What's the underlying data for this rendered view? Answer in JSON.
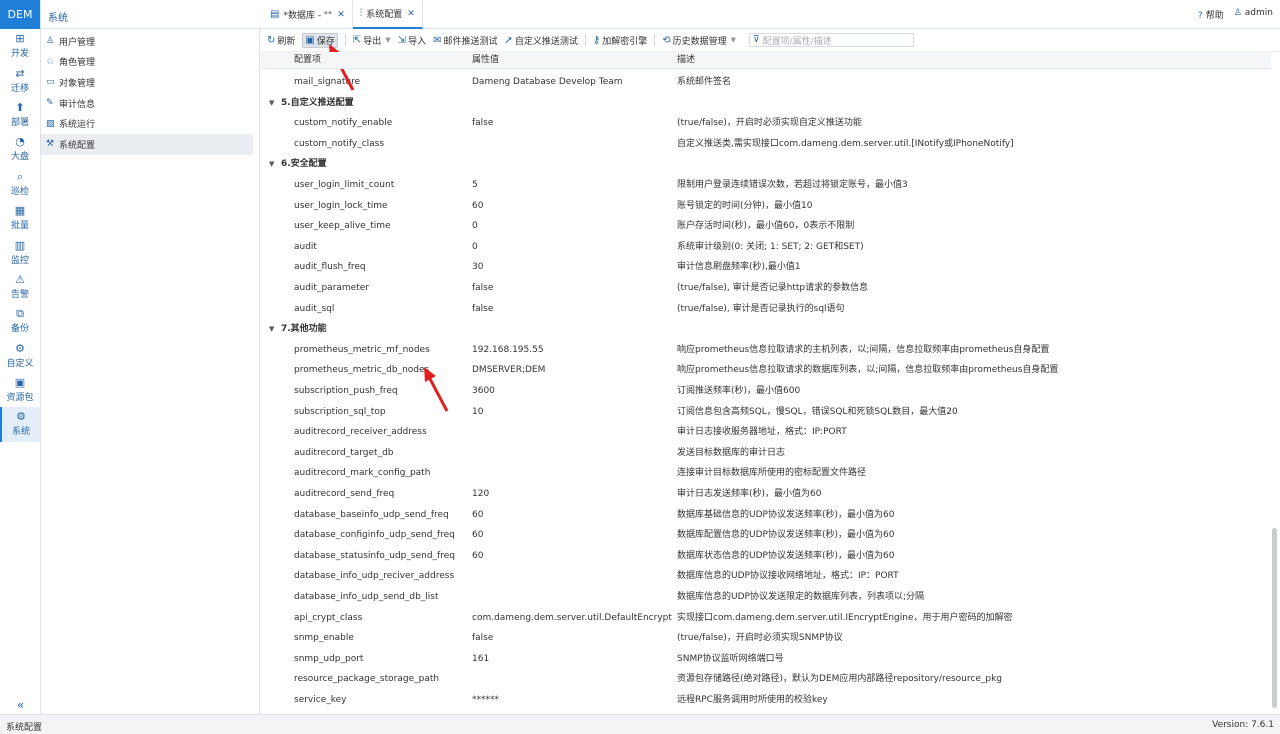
{
  "app": {
    "logo": "DEM",
    "section_title": "系统"
  },
  "header": {
    "tabs": [
      {
        "label": "*数据库 - \"\"",
        "icon": "table-icon",
        "active": false
      },
      {
        "label": "系统配置",
        "icon": "settings-sliders-icon",
        "active": true
      }
    ],
    "help_label": "帮助",
    "user_label": "admin"
  },
  "rail": {
    "items": [
      {
        "label": "开发",
        "icon": "grid-icon"
      },
      {
        "label": "迁移",
        "icon": "migrate-icon"
      },
      {
        "label": "部署",
        "icon": "deploy-icon"
      },
      {
        "label": "大盘",
        "icon": "dashboard-icon"
      },
      {
        "label": "巡检",
        "icon": "inspect-icon"
      },
      {
        "label": "批量",
        "icon": "batch-icon"
      },
      {
        "label": "监控",
        "icon": "monitor-icon"
      },
      {
        "label": "告警",
        "icon": "alarm-icon"
      },
      {
        "label": "备份",
        "icon": "backup-icon"
      },
      {
        "label": "自定义",
        "icon": "custom-icon"
      },
      {
        "label": "资源包",
        "icon": "package-icon"
      },
      {
        "label": "系统",
        "icon": "system-gear-icon"
      }
    ],
    "collapse_glyph": "«"
  },
  "nav": {
    "items": [
      {
        "label": "用户管理",
        "icon": "user-icon"
      },
      {
        "label": "角色管理",
        "icon": "role-icon"
      },
      {
        "label": "对象管理",
        "icon": "folder-icon"
      },
      {
        "label": "审计信息",
        "icon": "audit-icon"
      },
      {
        "label": "系统运行",
        "icon": "run-chart-icon"
      },
      {
        "label": "系统配置",
        "icon": "config-icon"
      }
    ]
  },
  "toolbar": {
    "refresh": "刷新",
    "save": "保存",
    "export": "导出",
    "import": "导入",
    "mail_test": "邮件推送测试",
    "custom_push_test": "自定义推送测试",
    "decrypt_index": "加解密引擎",
    "history": "历史数据管理",
    "filter_placeholder": "配置项/属性/描述"
  },
  "grid": {
    "headers": [
      "配置项",
      "属性值",
      "描述"
    ],
    "rows": [
      {
        "type": "row",
        "key": "mail_signature",
        "value": "Dameng Database Develop Team",
        "desc": "系统邮件签名"
      },
      {
        "type": "group",
        "name": "5.自定义推送配置"
      },
      {
        "type": "row",
        "key": "custom_notify_enable",
        "value": "false",
        "desc": "(true/false)，开启时必须实现自定义推送功能"
      },
      {
        "type": "row",
        "key": "custom_notify_class",
        "value": "",
        "desc": "自定义推送类,需实现接口com.dameng.dem.server.util.[INotify或IPhoneNotify]"
      },
      {
        "type": "group",
        "name": "6.安全配置"
      },
      {
        "type": "row",
        "key": "user_login_limit_count",
        "value": "5",
        "desc": "限制用户登录连续错误次数，若超过将锁定账号，最小值3"
      },
      {
        "type": "row",
        "key": "user_login_lock_time",
        "value": "60",
        "desc": "账号锁定的时间(分钟)，最小值10"
      },
      {
        "type": "row",
        "key": "user_keep_alive_time",
        "value": "0",
        "desc": "账户存活时间(秒)，最小值60，0表示不限制"
      },
      {
        "type": "row",
        "key": "audit",
        "value": "0",
        "desc": "系统审计级别(0: 关闭; 1: SET; 2: GET和SET)"
      },
      {
        "type": "row",
        "key": "audit_flush_freq",
        "value": "30",
        "desc": "审计信息刷盘频率(秒),最小值1"
      },
      {
        "type": "row",
        "key": "audit_parameter",
        "value": "false",
        "desc": "(true/false), 审计是否记录http请求的参数信息"
      },
      {
        "type": "row",
        "key": "audit_sql",
        "value": "false",
        "desc": "(true/false), 审计是否记录执行的sql语句"
      },
      {
        "type": "group",
        "name": "7.其他功能"
      },
      {
        "type": "row",
        "key": "prometheus_metric_mf_nodes",
        "value": "192.168.195.55",
        "desc": "响应prometheus信息拉取请求的主机列表，以;间隔，信息拉取频率由prometheus自身配置"
      },
      {
        "type": "row",
        "key": "prometheus_metric_db_nodes",
        "value": "DMSERVER;DEM",
        "desc": "响应prometheus信息拉取请求的数据库列表，以;间隔，信息拉取频率由prometheus自身配置"
      },
      {
        "type": "row",
        "key": "subscription_push_freq",
        "value": "3600",
        "desc": "订阅推送频率(秒)，最小值600"
      },
      {
        "type": "row",
        "key": "subscription_sql_top",
        "value": "10",
        "desc": "订阅信息包含高频SQL，慢SQL，错误SQL和死锁SQL数目，最大值20"
      },
      {
        "type": "row",
        "key": "auditrecord_receiver_address",
        "value": "",
        "desc": "审计日志接收服务器地址，格式：IP:PORT"
      },
      {
        "type": "row",
        "key": "auditrecord_target_db",
        "value": "",
        "desc": "发送目标数据库的审计日志"
      },
      {
        "type": "row",
        "key": "auditrecord_mark_config_path",
        "value": "",
        "desc": "连接审计目标数据库所使用的密标配置文件路径"
      },
      {
        "type": "row",
        "key": "auditrecord_send_freq",
        "value": "120",
        "desc": "审计日志发送频率(秒)，最小值为60"
      },
      {
        "type": "row",
        "key": "database_baseinfo_udp_send_freq",
        "value": "60",
        "desc": "数据库基础信息的UDP协议发送频率(秒)，最小值为60"
      },
      {
        "type": "row",
        "key": "database_configinfo_udp_send_freq",
        "value": "60",
        "desc": "数据库配置信息的UDP协议发送频率(秒)，最小值为60"
      },
      {
        "type": "row",
        "key": "database_statusinfo_udp_send_freq",
        "value": "60",
        "desc": "数据库状态信息的UDP协议发送频率(秒)，最小值为60"
      },
      {
        "type": "row",
        "key": "database_info_udp_reciver_address",
        "value": "",
        "desc": "数据库信息的UDP协议接收网络地址，格式：IP：PORT"
      },
      {
        "type": "row",
        "key": "database_info_udp_send_db_list",
        "value": "",
        "desc": "数据库信息的UDP协议发送限定的数据库列表，列表项以;分隔"
      },
      {
        "type": "row",
        "key": "api_crypt_class",
        "value": "com.dameng.dem.server.util.DefaultEncryptEngine",
        "desc": "实现接口com.dameng.dem.server.util.IEncryptEngine，用于用户密码的加解密"
      },
      {
        "type": "row",
        "key": "snmp_enable",
        "value": "false",
        "desc": "(true/false)，开启时必须实现SNMP协议"
      },
      {
        "type": "row",
        "key": "snmp_udp_port",
        "value": "161",
        "desc": "SNMP协议监听网络端口号"
      },
      {
        "type": "row",
        "key": "resource_package_storage_path",
        "value": "",
        "desc": "资源包存储路径(绝对路径)，默认为DEM应用内部路径repository/resource_pkg"
      },
      {
        "type": "row",
        "key": "service_key",
        "value": "******",
        "desc": "远程RPC服务调用时所使用的校验key"
      }
    ]
  },
  "status": {
    "left": "系统配置",
    "right": "Version: 7.6.1"
  },
  "colors": {
    "accent": "#1f7fd6",
    "arrow": "#e02020"
  }
}
